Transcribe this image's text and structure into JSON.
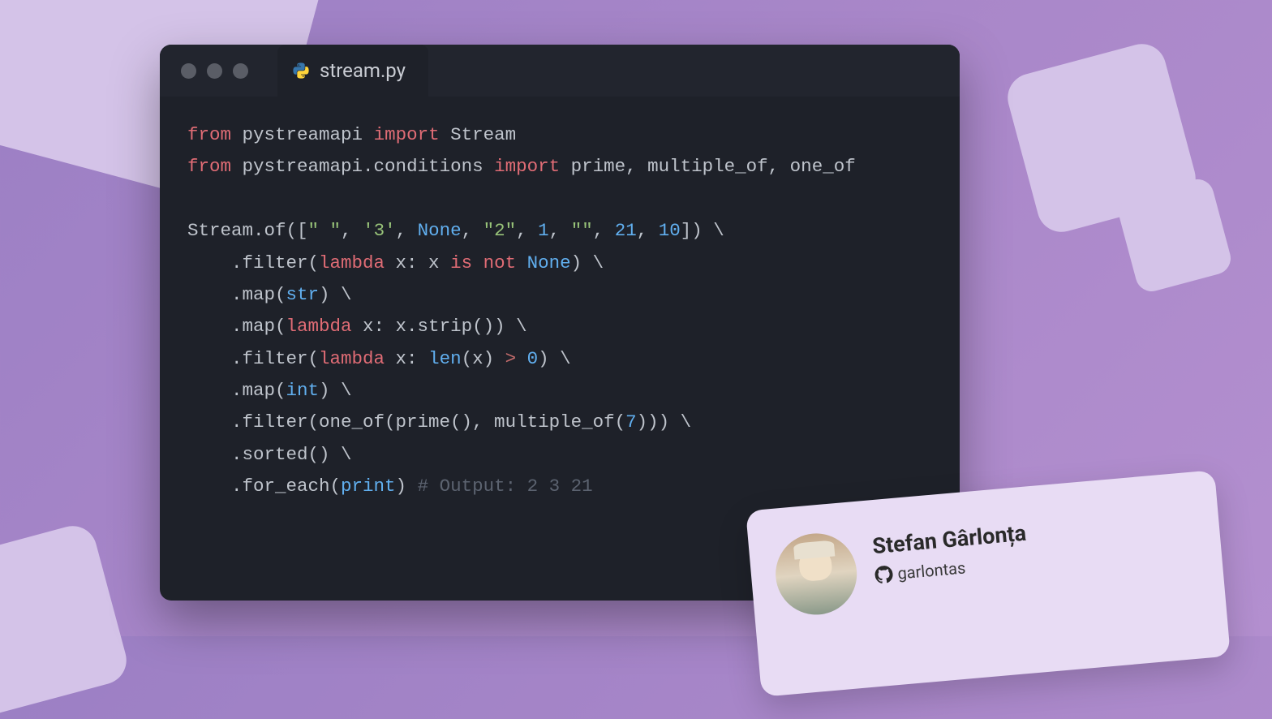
{
  "tab": {
    "filename": "stream.py"
  },
  "code": {
    "l1": {
      "from": "from",
      "mod1": "pystreamapi",
      "imp": "import",
      "name": "Stream"
    },
    "l2": {
      "from": "from",
      "mod2": "pystreamapi.conditions",
      "imp": "import",
      "names": "prime, multiple_of, one_of"
    },
    "l4_a": "Stream.of([",
    "l4_s1": "\" \"",
    "l4_c1": ", ",
    "l4_s2": "'3'",
    "l4_c2": ", ",
    "l4_none": "None",
    "l4_c3": ", ",
    "l4_s3": "\"2\"",
    "l4_c4": ", ",
    "l4_n1": "1",
    "l4_c5": ", ",
    "l4_s4": "\"\"",
    "l4_c6": ", ",
    "l4_n2": "21",
    "l4_c7": ", ",
    "l4_n3": "10",
    "l4_b": "]) \\",
    "l5_a": "    .filter(",
    "l5_lam": "lambda",
    "l5_b": " x: x ",
    "l5_is": "is",
    "l5_sp": " ",
    "l5_not": "not",
    "l5_sp2": " ",
    "l5_none": "None",
    "l5_c": ") \\",
    "l6_a": "    .map(",
    "l6_str": "str",
    "l6_b": ") \\",
    "l7_a": "    .map(",
    "l7_lam": "lambda",
    "l7_b": " x: x.strip()) \\",
    "l8_a": "    .filter(",
    "l8_lam": "lambda",
    "l8_b": " x: ",
    "l8_len": "len",
    "l8_c": "(x) ",
    "l8_op": ">",
    "l8_sp": " ",
    "l8_z": "0",
    "l8_d": ") \\",
    "l9_a": "    .map(",
    "l9_int": "int",
    "l9_b": ") \\",
    "l10_a": "    .filter(one_of(prime(), multiple_of(",
    "l10_n": "7",
    "l10_b": "))) \\",
    "l11": "    .sorted() \\",
    "l12_a": "    .for_each(",
    "l12_pr": "print",
    "l12_b": ") ",
    "l12_cm": "# Output: 2 3 21"
  },
  "card": {
    "name": "Stefan Gârlonța",
    "handle": "garlontas"
  }
}
